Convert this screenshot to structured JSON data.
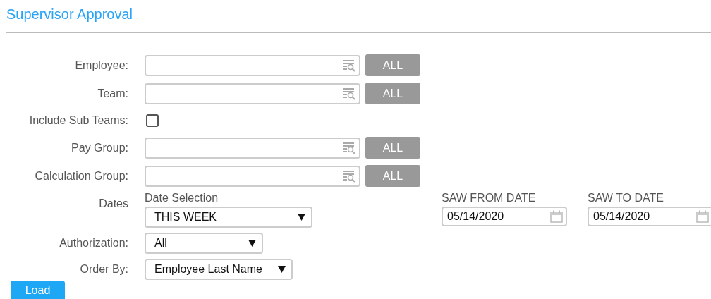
{
  "title": "Supervisor Approval",
  "rows": [
    {
      "kind": "lookup",
      "label": "Employee:",
      "button": "ALL"
    },
    {
      "kind": "lookup",
      "label": "Team:",
      "button": "ALL"
    },
    {
      "kind": "checkbox",
      "label": "Include Sub Teams:",
      "checked": false
    },
    {
      "kind": "lookup",
      "label": "Pay Group:",
      "button": "ALL"
    },
    {
      "kind": "lookup",
      "label": "Calculation Group:",
      "button": "ALL"
    },
    {
      "kind": "dates",
      "label": "Dates",
      "selection_label": "Date Selection",
      "selection_value": "THIS WEEK",
      "from_label": "SAW FROM DATE",
      "from_value": "05/14/2020",
      "to_label": "SAW TO DATE",
      "to_value": "05/14/2020"
    },
    {
      "kind": "select",
      "label": "Authorization:",
      "value": "All"
    },
    {
      "kind": "select",
      "label": "Order By:",
      "value": "Employee Last Name"
    }
  ],
  "load_button": "Load"
}
